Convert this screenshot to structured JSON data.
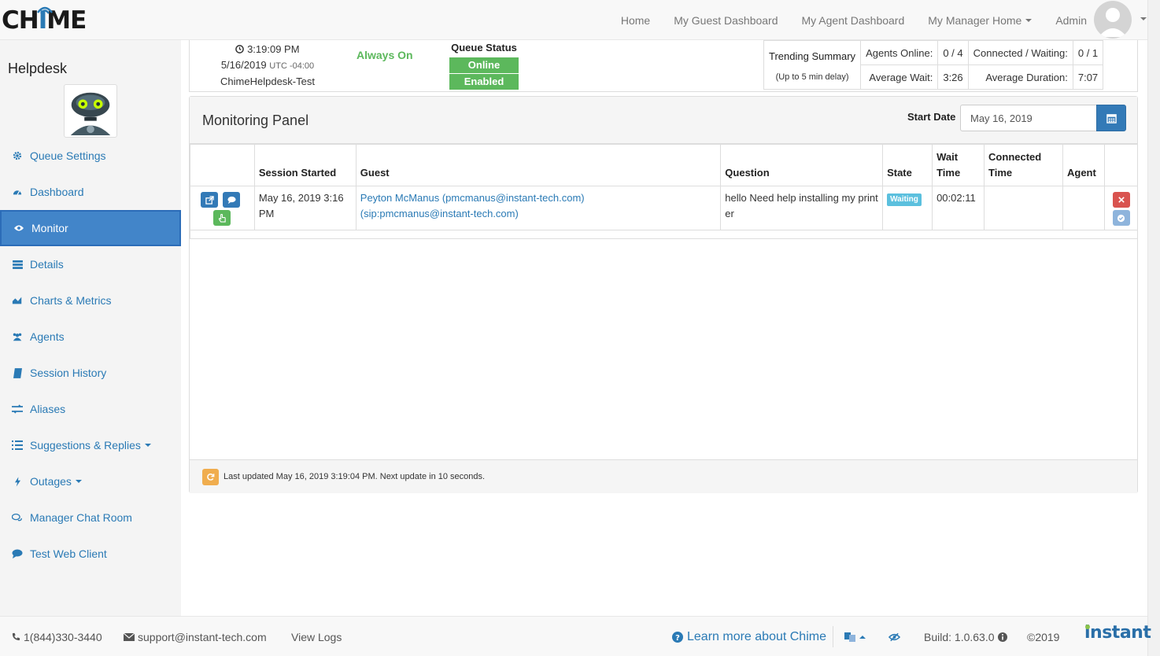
{
  "app": {
    "logo_prefix": "CH",
    "logo_accent": "I",
    "logo_suffix": "ME"
  },
  "nav": {
    "links": [
      "Home",
      "My Guest Dashboard",
      "My Agent Dashboard",
      "My Manager Home",
      "Admin"
    ],
    "avatar_icon": "user-avatar-icon"
  },
  "sidebar": {
    "queue_name": "Helpdesk",
    "items": [
      {
        "label": "Queue Settings",
        "icon": "gear-icon"
      },
      {
        "label": "Dashboard",
        "icon": "dashboard-icon"
      },
      {
        "label": "Monitor",
        "icon": "eye-icon",
        "active": true
      },
      {
        "label": "Details",
        "icon": "list-icon"
      },
      {
        "label": "Charts & Metrics",
        "icon": "area-chart-icon"
      },
      {
        "label": "Agents",
        "icon": "users-icon"
      },
      {
        "label": "Session History",
        "icon": "book-icon"
      },
      {
        "label": "Aliases",
        "icon": "exchange-icon"
      },
      {
        "label": "Suggestions & Replies",
        "icon": "list-ul-icon"
      },
      {
        "label": "Outages",
        "icon": "bolt-icon"
      },
      {
        "label": "Manager Chat Room",
        "icon": "comments-icon"
      },
      {
        "label": "Test Web Client",
        "icon": "comment-icon"
      }
    ]
  },
  "status": {
    "time": "3:19:09 PM",
    "date": "5/16/2019",
    "utc": "UTC -04:00",
    "queue_id": "ChimeHelpdesk-Test",
    "mode": "Always On",
    "queue_status_title": "Queue Status",
    "status_online": "Online",
    "status_enabled": "Enabled"
  },
  "trending": {
    "title": "Trending Summary",
    "subtitle": "(Up to 5 min delay)",
    "agents_online_label": "Agents Online:",
    "agents_online": "0 / 4",
    "connected_waiting_label": "Connected / Waiting:",
    "connected_waiting": "0 / 1",
    "avg_wait_label": "Average Wait:",
    "avg_wait": "3:26",
    "avg_duration_label": "Average Duration:",
    "avg_duration": "7:07"
  },
  "monitor": {
    "title": "Monitoring Panel",
    "start_date_label": "Start Date",
    "start_date_value": "May 16, 2019",
    "columns": [
      "",
      "Session Started",
      "Guest",
      "Question",
      "State",
      "Wait Time",
      "Connected Time",
      "Agent",
      ""
    ],
    "rows": [
      {
        "session_started": "May 16, 2019 3:16 PM",
        "guest_name": "Peyton McManus (pmcmanus@instant-tech.com)",
        "guest_sip": "(sip:pmcmanus@instant-tech.com)",
        "question": "hello Need help installing my printer",
        "state": "Waiting",
        "wait_time": "00:02:11",
        "connected_time": "",
        "agent": ""
      }
    ],
    "last_updated": "Last updated May 16, 2019 3:19:04 PM. Next update in 10 seconds."
  },
  "footer": {
    "phone": "1(844)330-3440",
    "email": "support@instant-tech.com",
    "view_logs": "View Logs",
    "learn_more": "Learn more about Chime",
    "build": "Build: 1.0.63.0",
    "copyright": "©2019",
    "brand": "instant"
  },
  "colors": {
    "primary": "#337ab7",
    "link": "#2a7ab5",
    "success": "#5cb85c",
    "info": "#5bc0de",
    "danger": "#d9534f",
    "warning": "#f0ad4e"
  }
}
